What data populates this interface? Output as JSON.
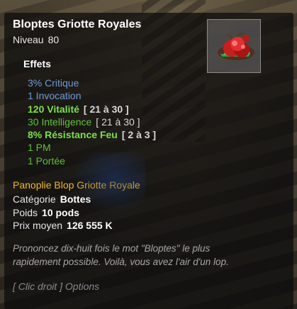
{
  "item": {
    "name": "Bloptes Griotte Royales",
    "level_label": "Niveau",
    "level": "80",
    "icon": "red-boots-icon"
  },
  "effects": {
    "header": "Effets",
    "lines": [
      {
        "text": "3% Critique",
        "range": "",
        "color": "#6f9bd6"
      },
      {
        "text": "1 Invocation",
        "range": "",
        "color": "#6f9bd6"
      },
      {
        "text": "120 Vitalité",
        "range": "[ 21 à 30 ]",
        "color": "#7ee04a"
      },
      {
        "text": "30 Intelligence",
        "range": "[ 21 à 30 ]",
        "color": "#5ec03a"
      },
      {
        "text": "8% Résistance Feu",
        "range": "[ 2 à 3 ]",
        "color": "#7ee04a"
      },
      {
        "text": "1 PM",
        "range": "",
        "color": "#5ec03a"
      },
      {
        "text": "1 Portée",
        "range": "",
        "color": "#5ec03a"
      }
    ]
  },
  "set": {
    "name": "Panoplie Blop Griotte Royale",
    "color": "#f0b825"
  },
  "info": {
    "category_label": "Catégorie",
    "category_value": "Bottes",
    "weight_label": "Poids",
    "weight_value": "10 pods",
    "price_label": "Prix moyen",
    "price_value": "126 555 K"
  },
  "description": "Prononcez dix-huit fois le mot \"Bloptes\" le plus rapidement possible. Voilà, vous avez l'air d'un lop.",
  "hint": "[ Clic droit ] Options"
}
